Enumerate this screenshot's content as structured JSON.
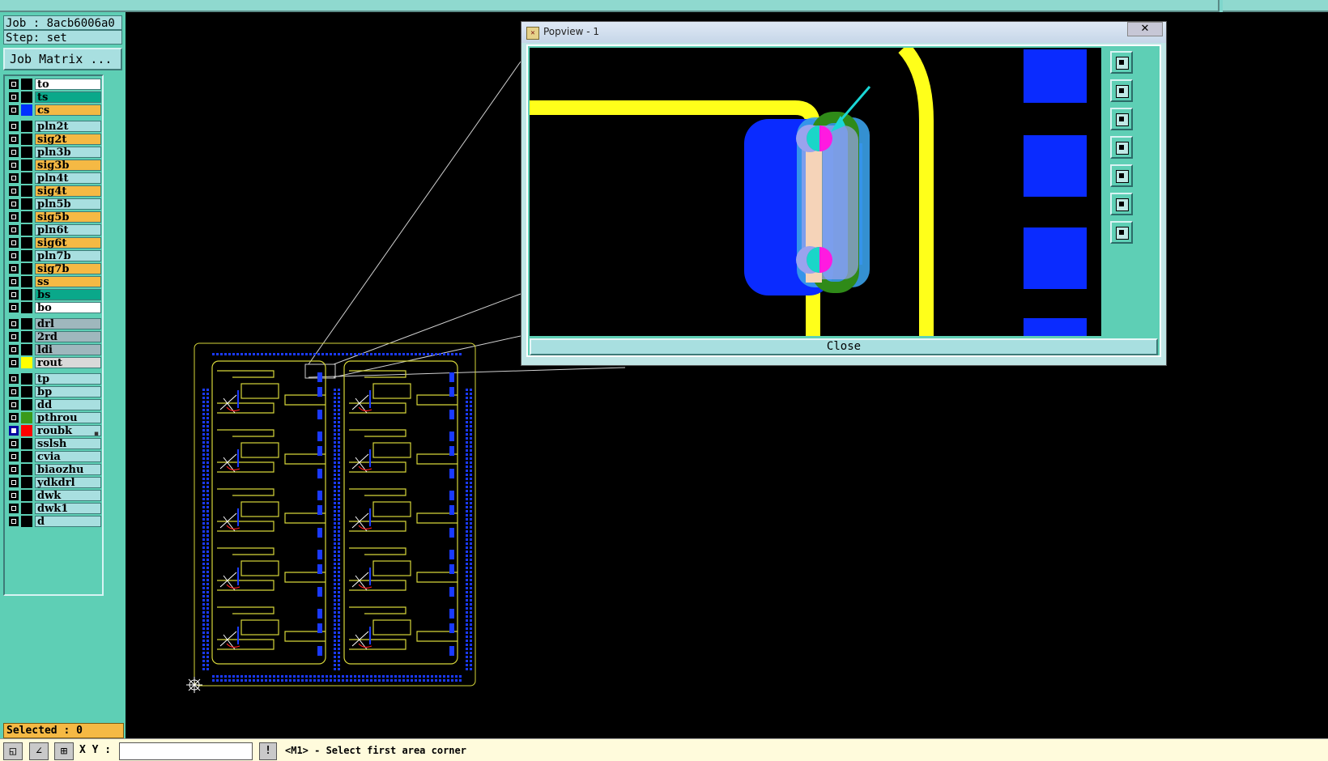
{
  "job": {
    "label": "Job : 8acb6006a0",
    "step": "Step: set",
    "matrix_button": "Job Matrix ..."
  },
  "layers": [
    {
      "name": "to",
      "color": "#ffffff",
      "swatch": "#000000",
      "active": false
    },
    {
      "name": "ts",
      "color": "#0aa88a",
      "swatch": "#000000",
      "active": false
    },
    {
      "name": "cs",
      "color": "#f5b944",
      "swatch": "#0030ff",
      "active": false
    },
    {
      "name": "pln2t",
      "color": "#a8dfe0",
      "swatch": "#000000",
      "active": false
    },
    {
      "name": "sig2t",
      "color": "#f5b944",
      "swatch": "#000000",
      "active": false
    },
    {
      "name": "pln3b",
      "color": "#a8dfe0",
      "swatch": "#000000",
      "active": false
    },
    {
      "name": "sig3b",
      "color": "#f5b944",
      "swatch": "#000000",
      "active": false
    },
    {
      "name": "pln4t",
      "color": "#a8dfe0",
      "swatch": "#000000",
      "active": false
    },
    {
      "name": "sig4t",
      "color": "#f5b944",
      "swatch": "#000000",
      "active": false
    },
    {
      "name": "pln5b",
      "color": "#a8dfe0",
      "swatch": "#000000",
      "active": false
    },
    {
      "name": "sig5b",
      "color": "#f5b944",
      "swatch": "#000000",
      "active": false
    },
    {
      "name": "pln6t",
      "color": "#a8dfe0",
      "swatch": "#000000",
      "active": false
    },
    {
      "name": "sig6t",
      "color": "#f5b944",
      "swatch": "#000000",
      "active": false
    },
    {
      "name": "pln7b",
      "color": "#a8dfe0",
      "swatch": "#000000",
      "active": false
    },
    {
      "name": "sig7b",
      "color": "#f5b944",
      "swatch": "#000000",
      "active": false
    },
    {
      "name": "ss",
      "color": "#f5b944",
      "swatch": "#000000",
      "active": false
    },
    {
      "name": "bs",
      "color": "#0aa88a",
      "swatch": "#000000",
      "active": false
    },
    {
      "name": "bo",
      "color": "#ffffff",
      "swatch": "#000000",
      "active": false
    },
    {
      "name": "drl",
      "color": "#9fb7bd",
      "swatch": "#000000",
      "active": false
    },
    {
      "name": "2rd",
      "color": "#9fb7bd",
      "swatch": "#000000",
      "active": false
    },
    {
      "name": "ldi",
      "color": "#9fb7bd",
      "swatch": "#000000",
      "active": false
    },
    {
      "name": "rout",
      "color": "#d9d9d9",
      "swatch": "#ffff00",
      "active": false
    },
    {
      "name": "tp",
      "color": "#a8dfe0",
      "swatch": "#000000",
      "active": false
    },
    {
      "name": "bp",
      "color": "#a8dfe0",
      "swatch": "#000000",
      "active": false
    },
    {
      "name": "dd",
      "color": "#a8dfe0",
      "swatch": "#000000",
      "active": false
    },
    {
      "name": "pthrou",
      "color": "#a8dfe0",
      "swatch": "#3a9a1a",
      "active": false
    },
    {
      "name": "roubk",
      "color": "#a8dfe0",
      "swatch": "#ff0000",
      "active": true
    },
    {
      "name": "sslsh",
      "color": "#a8dfe0",
      "swatch": "#000000",
      "active": false
    },
    {
      "name": "cvia",
      "color": "#a8dfe0",
      "swatch": "#000000",
      "active": false
    },
    {
      "name": "biaozhu",
      "color": "#a8dfe0",
      "swatch": "#000000",
      "active": false
    },
    {
      "name": "ydkdrl",
      "color": "#a8dfe0",
      "swatch": "#000000",
      "active": false
    },
    {
      "name": "dwk",
      "color": "#a8dfe0",
      "swatch": "#000000",
      "active": false
    },
    {
      "name": "dwk1",
      "color": "#a8dfe0",
      "swatch": "#000000",
      "active": false
    },
    {
      "name": "d",
      "color": "#a8dfe0",
      "swatch": "#000000",
      "active": false
    }
  ],
  "selected": "Selected : 0",
  "popview": {
    "title": "Popview - 1",
    "close_x": "✕",
    "close_button": "Close",
    "tools": [
      "zoom-window-icon",
      "pan-up-icon",
      "pan-down-icon",
      "pan-left-icon",
      "pan-right-icon",
      "zoom-out-icon",
      "zoom-fit-icon"
    ]
  },
  "status": {
    "xy_label": "X Y :",
    "xy_value": "",
    "prompt": "<M1> - Select first area corner",
    "exclaim": "!",
    "tool_icons": [
      "zoom-area-icon",
      "measure-icon",
      "grid-icon"
    ]
  }
}
